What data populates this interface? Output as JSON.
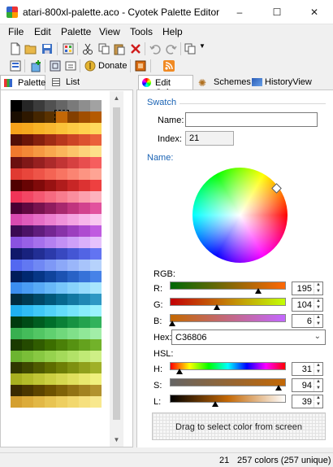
{
  "window": {
    "title": "atari-800xl-palette.aco - Cyotek Palette Editor",
    "minimize": "–",
    "maximize": "☐",
    "close": "✕"
  },
  "menu": [
    "File",
    "Edit",
    "Palette",
    "View",
    "Tools",
    "Help"
  ],
  "toolbar": {
    "donate_label": "Donate"
  },
  "left_tabs": [
    "Palette",
    "List"
  ],
  "right_tabs": [
    "Edit Color",
    "Schemes",
    "HistoryView"
  ],
  "swatch_section": {
    "title": "Swatch",
    "name_label": "Name:",
    "name_value": "",
    "index_label": "Index:",
    "index_value": "21"
  },
  "name_section_title": "Name:",
  "rgb": {
    "title": "RGB:",
    "r_label": "R:",
    "r_value": "195",
    "g_label": "G:",
    "g_value": "104",
    "b_label": "B:",
    "b_value": "6",
    "r_level": 0.765,
    "g_level": 0.408,
    "b_level": 0.024
  },
  "hex": {
    "label": "Hex:",
    "value": "C36806"
  },
  "hsl": {
    "title": "HSL:",
    "h_label": "H:",
    "h_value": "31",
    "s_label": "S:",
    "s_value": "94",
    "l_label": "L:",
    "l_value": "39",
    "h_level": 0.086,
    "s_level": 0.94,
    "l_level": 0.39
  },
  "drag_label": "Drag to select color from screen",
  "status": {
    "index": "21",
    "colors": "257 colors (257 unique)"
  },
  "selected_color": "#C36806",
  "palette": [
    [
      "#000000",
      "#262626",
      "#3b3b3b",
      "#515151",
      "#656565",
      "#7a7a7a",
      "#8e8e8e",
      "#a2a2a2"
    ],
    [
      "#1a0d00",
      "#2e1800",
      "#452600",
      "#5a3200",
      "#c36806",
      "#833f00",
      "#a04e00",
      "#b55a00"
    ],
    [
      "#f6a21b",
      "#f5a81e",
      "#f7b326",
      "#f9b830",
      "#fbc239",
      "#fdca44",
      "#ffd24e",
      "#ffd95d"
    ],
    [
      "#520e06",
      "#6c1508",
      "#86200d",
      "#a02c14",
      "#b8371c",
      "#cc4425",
      "#dc522f",
      "#ea603a"
    ],
    [
      "#f07a2e",
      "#f38837",
      "#f69842",
      "#f9a74e",
      "#fbb55b",
      "#fcc46a",
      "#fdd27a",
      "#fde08a"
    ],
    [
      "#6a1010",
      "#801818",
      "#962020",
      "#ac2a2a",
      "#c23434",
      "#d64040",
      "#e84e4e",
      "#f65e5e"
    ],
    [
      "#e03a32",
      "#e8463c",
      "#ee5448",
      "#f46454",
      "#f87462",
      "#fb8472",
      "#fd9482",
      "#fea494"
    ],
    [
      "#500000",
      "#680404",
      "#800a0a",
      "#981212",
      "#b01c1c",
      "#c82626",
      "#dc3232",
      "#ee4040"
    ],
    [
      "#f03458",
      "#f24664",
      "#f45872",
      "#f66a80",
      "#f87c8e",
      "#fa8e9e",
      "#fca0ae",
      "#fdb2be"
    ],
    [
      "#4a0034",
      "#600840",
      "#78124e",
      "#901c5e",
      "#a8286e",
      "#c0347e",
      "#d2428e",
      "#e2529e"
    ],
    [
      "#d84ab0",
      "#e05cbc",
      "#e66ec6",
      "#ec80d0",
      "#f092da",
      "#f4a4e2",
      "#f8b6ea",
      "#fac8f0"
    ],
    [
      "#3a0a52",
      "#4c1266",
      "#601c7c",
      "#742692",
      "#8832a8",
      "#9c3ebe",
      "#ae4cd0",
      "#c05ce0"
    ],
    [
      "#8a52e0",
      "#9860e6",
      "#a670ec",
      "#b480f0",
      "#c290f4",
      "#cea0f8",
      "#dab0fa",
      "#e6c2fc"
    ],
    [
      "#10186a",
      "#18227e",
      "#222e94",
      "#2c3aaa",
      "#3848c0",
      "#4456d4",
      "#5264e4",
      "#6274f2"
    ],
    [
      "#5468f0",
      "#6278f2",
      "#7088f4",
      "#7e98f6",
      "#8ca8f8",
      "#9ab6fa",
      "#a8c4fb",
      "#b6d2fc"
    ],
    [
      "#001c5a",
      "#002870",
      "#063686",
      "#10449c",
      "#1c52b2",
      "#2862c6",
      "#3672d8",
      "#4682e8"
    ],
    [
      "#3c8ef0",
      "#4a9cf4",
      "#58aaf6",
      "#68b8f8",
      "#78c6fa",
      "#88d2fb",
      "#98dcfc",
      "#a8e6fd"
    ],
    [
      "#002c40",
      "#003a52",
      "#004866",
      "#00587a",
      "#06688e",
      "#1278a2",
      "#2088b4",
      "#2e98c4"
    ],
    [
      "#20b0f0",
      "#30bcf4",
      "#40c8f6",
      "#52d2f8",
      "#64dcfa",
      "#76e4fb",
      "#88ecfc",
      "#9af2fd"
    ],
    [
      "#003a0e",
      "#004a16",
      "#005c20",
      "#006e2a",
      "#0a8036",
      "#169242",
      "#24a24e",
      "#32b25c"
    ],
    [
      "#38b050",
      "#44bc5a",
      "#52c664",
      "#60d070",
      "#70d87c",
      "#80e08a",
      "#90e898",
      "#a2eea8"
    ],
    [
      "#1a3a00",
      "#244a00",
      "#305c00",
      "#3c6e00",
      "#4a8008",
      "#569212",
      "#64a21e",
      "#72b22a"
    ],
    [
      "#6cb430",
      "#7abe38",
      "#88c842",
      "#96d24e",
      "#a4da5a",
      "#b2e268",
      "#c0ea76",
      "#ceef86"
    ],
    [
      "#303800",
      "#3e4800",
      "#4e5a00",
      "#5e6c00",
      "#6e7e06",
      "#7e9010",
      "#90a01c",
      "#a0b028"
    ],
    [
      "#a8b020",
      "#b4bc2a",
      "#c0c636",
      "#ccd042",
      "#d6d850",
      "#e0e05e",
      "#e8e86e",
      "#f0f07e"
    ],
    [
      "#3a2a00",
      "#4a3600",
      "#5c4400",
      "#6e5200",
      "#806208",
      "#927214",
      "#a28220",
      "#b2922e"
    ],
    [
      "#d4a030",
      "#dcac3a",
      "#e2b846",
      "#e8c452",
      "#eecf60",
      "#f2d86e",
      "#f6e07e",
      "#f8e88e"
    ]
  ]
}
